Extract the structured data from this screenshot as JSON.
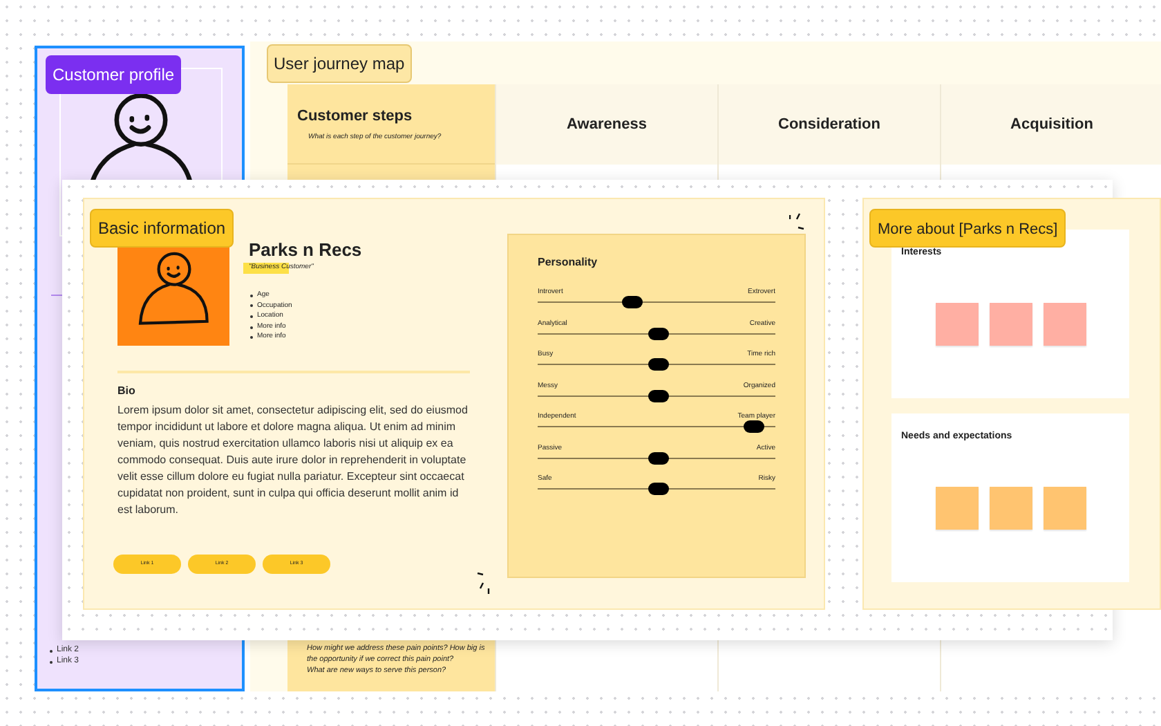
{
  "customer_profile": {
    "label": "Customer profile",
    "links": [
      "Link 2",
      "Link 3"
    ]
  },
  "journey_map": {
    "label": "User journey map",
    "columns": [
      {
        "title": "Customer steps",
        "subtitle": "What is each step of the customer journey?"
      },
      {
        "title": "Awareness"
      },
      {
        "title": "Consideration"
      },
      {
        "title": "Acquisition"
      }
    ],
    "bottom_note": [
      "How might we address these pain points? How big is the opportunity if we correct this pain point?",
      "What are new ways to serve this person?"
    ]
  },
  "basic_information": {
    "label": "Basic information",
    "name": "Parks n Recs",
    "tagline": "\"Business Customer\"",
    "facts": [
      "Age",
      "Occupation",
      "Location",
      "More info",
      "More info"
    ],
    "bio_title": "Bio",
    "bio": "Lorem ipsum dolor sit amet, consectetur adipiscing elit, sed do eiusmod tempor incididunt ut labore et dolore magna aliqua. Ut enim ad minim veniam, quis nostrud exercitation ullamco laboris nisi ut aliquip ex ea commodo consequat. Duis aute irure dolor in reprehenderit in voluptate velit esse cillum dolore eu fugiat nulla pariatur. Excepteur sint occaecat cupidatat non proident, sunt in culpa qui officia deserunt mollit anim id est laborum.",
    "links": [
      "Link 1",
      "Link 2",
      "Link 3"
    ]
  },
  "personality": {
    "title": "Personality",
    "traits": [
      {
        "left": "Introvert",
        "right": "Extrovert",
        "level": 0.4
      },
      {
        "left": "Analytical",
        "right": "Creative",
        "level": 0.51
      },
      {
        "left": "Busy",
        "right": "Time rich",
        "level": 0.51
      },
      {
        "left": "Messy",
        "right": "Organized",
        "level": 0.51
      },
      {
        "left": "Independent",
        "right": "Team player",
        "level": 0.91
      },
      {
        "left": "Passive",
        "right": "Active",
        "level": 0.51
      },
      {
        "left": "Safe",
        "right": "Risky",
        "level": 0.51
      }
    ]
  },
  "more_about": {
    "label": "More about [Parks n Recs]",
    "sections": [
      {
        "title": "Interests",
        "notes": [
          {
            "color": "#ffafa3"
          },
          {
            "color": "#ffafa3"
          },
          {
            "color": "#ffafa3"
          }
        ]
      },
      {
        "title": "Needs and expectations",
        "notes": [
          {
            "color": "#ffc470"
          },
          {
            "color": "#ffc470"
          },
          {
            "color": "#ffc470"
          }
        ]
      }
    ]
  }
}
